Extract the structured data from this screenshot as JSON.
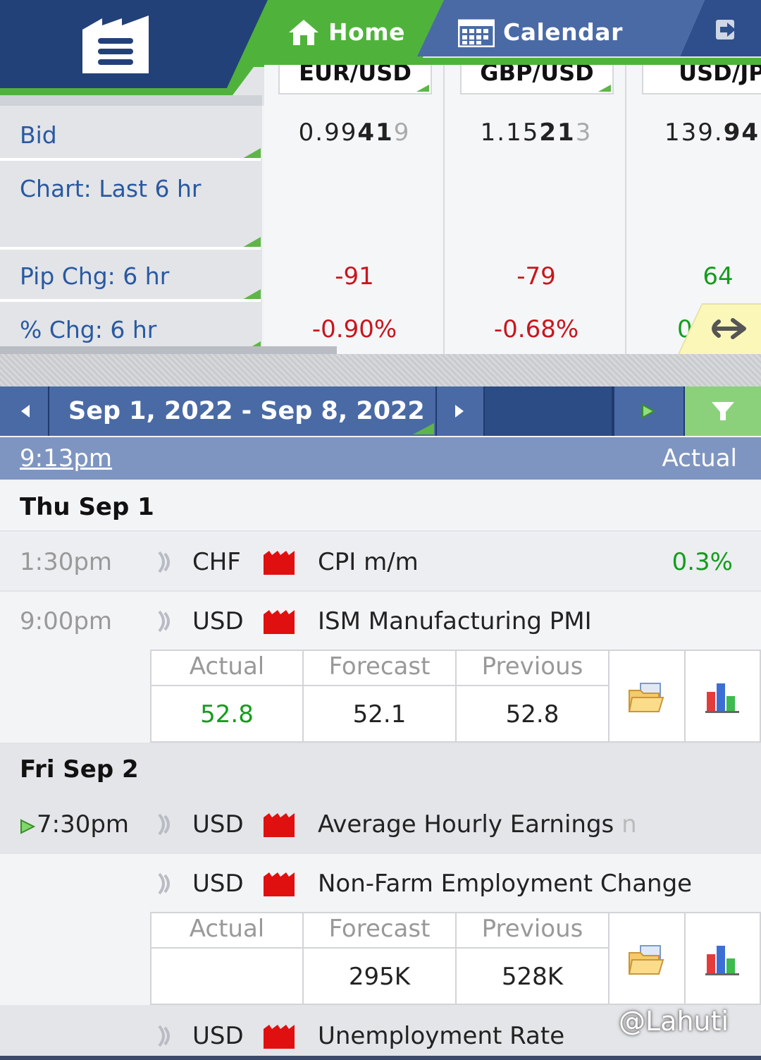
{
  "nav": {
    "home_label": "Home",
    "calendar_label": "Calendar"
  },
  "quotes": {
    "labels": {
      "bid": "Bid",
      "chart": "Chart: Last 6 hr",
      "pip": "Pip Chg: 6 hr",
      "pct": "% Chg: 6 hr"
    },
    "pairs": [
      {
        "symbol": "EUR/USD",
        "bid_pre": "0.99",
        "bid_big": "41",
        "bid_post": "9",
        "pip_chg": "-91",
        "pct_chg": "-0.90%"
      },
      {
        "symbol": "GBP/USD",
        "bid_pre": "1.15",
        "bid_big": "21",
        "bid_post": "3",
        "pip_chg": "-79",
        "pct_chg": "-0.68%"
      },
      {
        "symbol": "USD/JPY",
        "bid_pre": "139.",
        "bid_big": "94",
        "bid_post": "",
        "pip_chg": "64",
        "pct_chg": "0"
      }
    ]
  },
  "calendar": {
    "range_label": "Sep 1, 2022 - Sep 8, 2022",
    "current_time": "9:13pm",
    "actual_header": "Actual",
    "grid_headers": {
      "actual": "Actual",
      "forecast": "Forecast",
      "previous": "Previous"
    },
    "days": [
      {
        "label": "Thu Sep 1"
      },
      {
        "label": "Fri Sep 2"
      }
    ],
    "events": [
      {
        "time": "1:30pm",
        "currency": "CHF",
        "name": "CPI m/m",
        "actual": "0.3%"
      },
      {
        "time": "9:00pm",
        "currency": "USD",
        "name": "ISM Manufacturing PMI",
        "actual": "52.8",
        "forecast": "52.1",
        "previous": "52.8"
      },
      {
        "time": "7:30pm",
        "currency": "USD",
        "name": "Average Hourly Earnings",
        "name_tail": "n"
      },
      {
        "time": "",
        "currency": "USD",
        "name": "Non-Farm Employment Change",
        "actual": "",
        "forecast": "295K",
        "previous": "528K"
      },
      {
        "time": "",
        "currency": "USD",
        "name": "Unemployment Rate"
      }
    ]
  },
  "watermark": "@Lahuti",
  "colors": {
    "navy": "#1f3a6e",
    "green_accent": "#4fb33b",
    "label_blue": "#2a59a0",
    "negative": "#c8161d",
    "positive": "#149d1c"
  },
  "icons": [
    "menu-icon",
    "home-icon",
    "calendar-icon",
    "exit-icon",
    "arrow-left-icon",
    "arrow-right-icon",
    "play-icon",
    "filter-icon",
    "sound-icon",
    "flag-icon",
    "folder-icon",
    "bar-chart-icon"
  ]
}
